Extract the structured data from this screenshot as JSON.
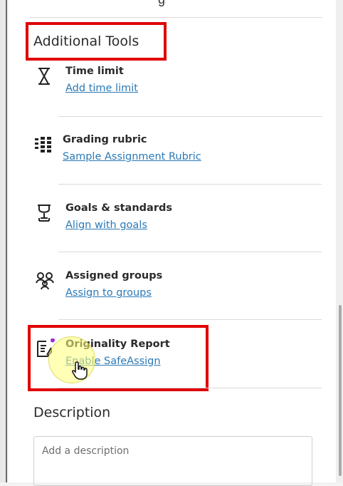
{
  "header": {
    "partial_title": "g"
  },
  "section": {
    "title": "Additional Tools"
  },
  "tools": [
    {
      "title": "Time limit",
      "link": "Add time limit",
      "icon": "hourglass-icon"
    },
    {
      "title": "Grading rubric",
      "link": "Sample Assignment Rubric",
      "icon": "rubric-grid-icon"
    },
    {
      "title": "Goals & standards",
      "link": "Align with goals",
      "icon": "trophy-icon"
    },
    {
      "title": "Assigned groups",
      "link": "Assign to groups",
      "icon": "groups-icon"
    },
    {
      "title": "Originality Report",
      "link": "Enable SafeAssign",
      "icon": "originality-report-icon"
    }
  ],
  "description": {
    "title": "Description",
    "placeholder": "Add a description"
  },
  "colors": {
    "highlight": "#e00000",
    "link": "#2a79b7",
    "notification_dot": "#9b2fd1",
    "cursor_halo": "#ffff78"
  }
}
